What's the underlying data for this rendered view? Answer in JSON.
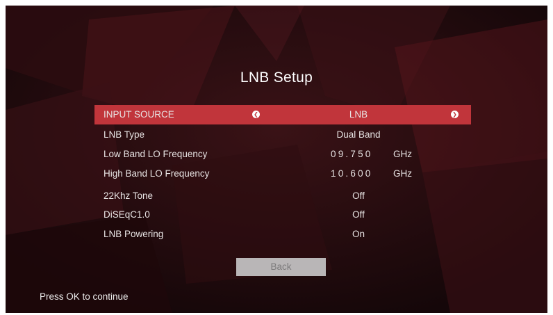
{
  "screen": {
    "title": "LNB Setup",
    "hint": "Press OK to continue"
  },
  "settings": {
    "input_source": {
      "label": "INPUT SOURCE",
      "value": "LNB",
      "left_icon": "chevron-left-icon",
      "right_icon": "chevron-right-icon"
    },
    "lnb_type": {
      "label": "LNB Type",
      "value": "Dual Band"
    },
    "low_band": {
      "label": "Low Band LO Frequency",
      "value": "09.750",
      "unit": "GHz"
    },
    "high_band": {
      "label": "High Band LO Frequency",
      "value": "10.600",
      "unit": "GHz"
    },
    "tone": {
      "label": "22Khz Tone",
      "value": "Off"
    },
    "diseqc": {
      "label": "DiSEqC1.0",
      "value": "Off"
    },
    "powering": {
      "label": "LNB Powering",
      "value": "On"
    }
  },
  "buttons": {
    "back_label": "Back"
  },
  "colors": {
    "highlight": "#c1353b",
    "background": "#1a0a0c",
    "button": "#b9b6b7"
  }
}
